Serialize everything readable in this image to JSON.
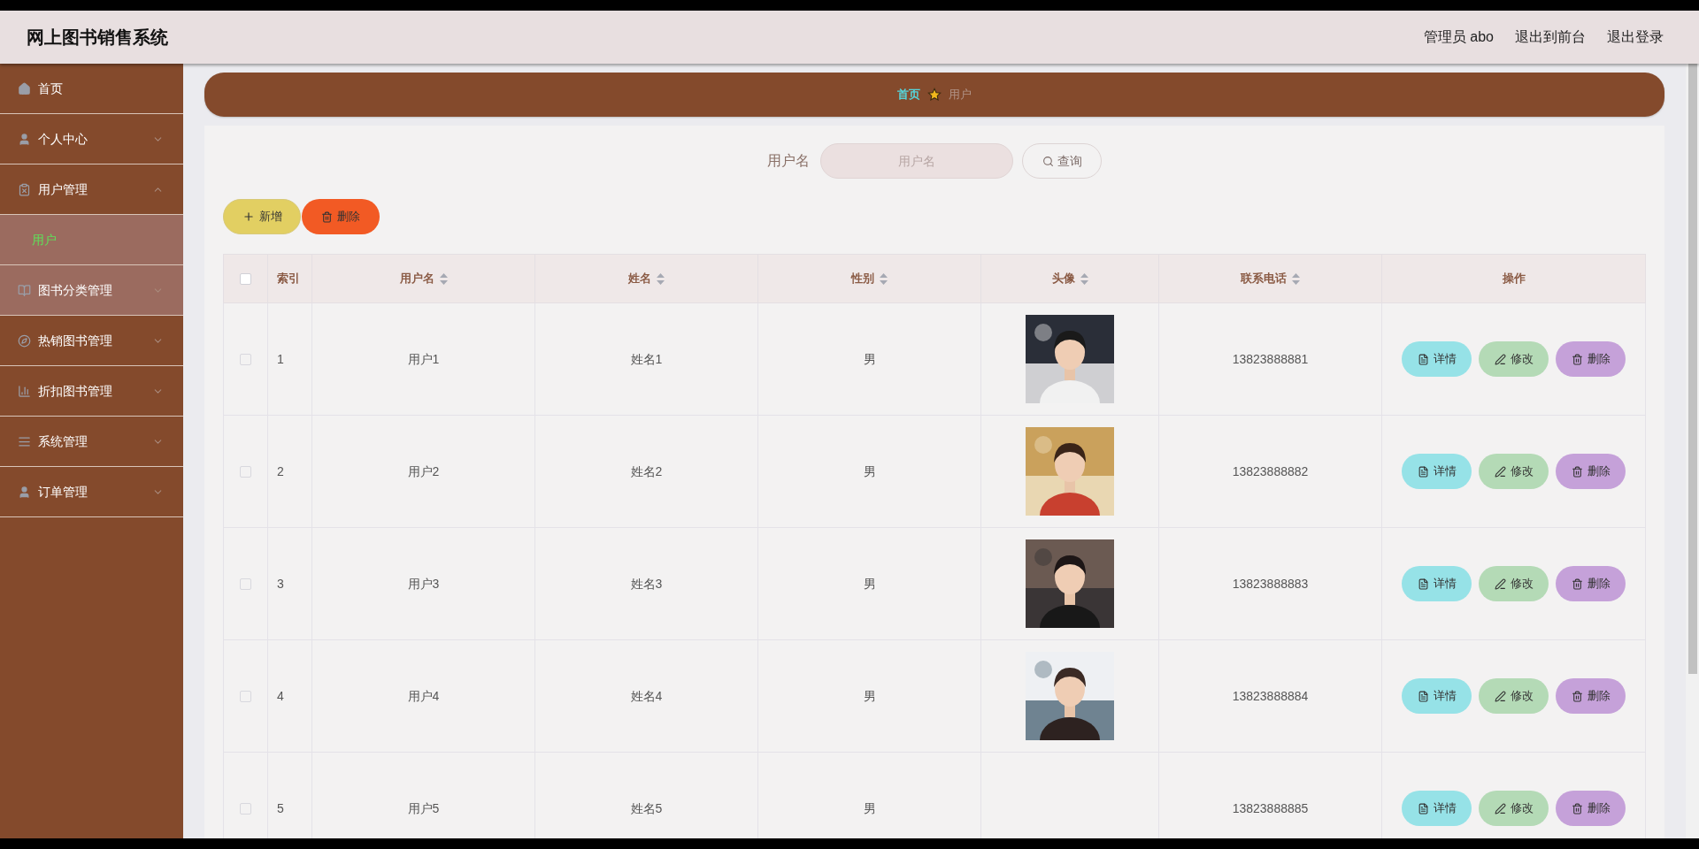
{
  "header": {
    "title": "网上图书销售系统",
    "links": [
      "管理员 abo",
      "退出到前台",
      "退出登录"
    ]
  },
  "sidebar": {
    "items": [
      {
        "label": "首页",
        "expandable": false,
        "expanded": false,
        "highlighted": false
      },
      {
        "label": "个人中心",
        "expandable": true,
        "expanded": false,
        "highlighted": false
      },
      {
        "label": "用户管理",
        "expandable": true,
        "expanded": true,
        "highlighted": false,
        "children": [
          {
            "label": "用户",
            "selected": true
          }
        ]
      },
      {
        "label": "图书分类管理",
        "expandable": true,
        "expanded": false,
        "highlighted": true
      },
      {
        "label": "热销图书管理",
        "expandable": true,
        "expanded": false,
        "highlighted": false
      },
      {
        "label": "折扣图书管理",
        "expandable": true,
        "expanded": false,
        "highlighted": false
      },
      {
        "label": "系统管理",
        "expandable": true,
        "expanded": false,
        "highlighted": false
      },
      {
        "label": "订单管理",
        "expandable": true,
        "expanded": false,
        "highlighted": false
      }
    ]
  },
  "breadcrumb": [
    "首页",
    "用户"
  ],
  "search": {
    "label": "用户名",
    "placeholder": "用户名",
    "button": "查询"
  },
  "toolbar": {
    "add": "新增",
    "delete": "删除"
  },
  "table": {
    "all_checked": false,
    "columns": [
      {
        "label": "索引",
        "sortable": false
      },
      {
        "label": "用户名",
        "sortable": true
      },
      {
        "label": "姓名",
        "sortable": true
      },
      {
        "label": "性别",
        "sortable": true
      },
      {
        "label": "头像",
        "sortable": true
      },
      {
        "label": "联系电话",
        "sortable": true
      },
      {
        "label": "操作",
        "sortable": false
      }
    ],
    "rows": [
      {
        "checked": false,
        "index": "1",
        "username": "用户1",
        "name": "姓名1",
        "gender": "男",
        "phone": "13823888881",
        "actions": [
          "详情",
          "修改",
          "删除"
        ]
      },
      {
        "checked": false,
        "index": "2",
        "username": "用户2",
        "name": "姓名2",
        "gender": "男",
        "phone": "13823888882",
        "actions": [
          "详情",
          "修改",
          "删除"
        ]
      },
      {
        "checked": false,
        "index": "3",
        "username": "用户3",
        "name": "姓名3",
        "gender": "男",
        "phone": "13823888883",
        "actions": [
          "详情",
          "修改",
          "删除"
        ]
      },
      {
        "checked": false,
        "index": "4",
        "username": "用户4",
        "name": "姓名4",
        "gender": "男",
        "phone": "13823888884",
        "actions": [
          "详情",
          "修改",
          "删除"
        ]
      },
      {
        "checked": false,
        "index": "5",
        "username": "用户5",
        "name": "姓名5",
        "gender": "男",
        "phone": "13823888885",
        "actions": [
          "详情",
          "修改",
          "删除"
        ]
      }
    ]
  }
}
